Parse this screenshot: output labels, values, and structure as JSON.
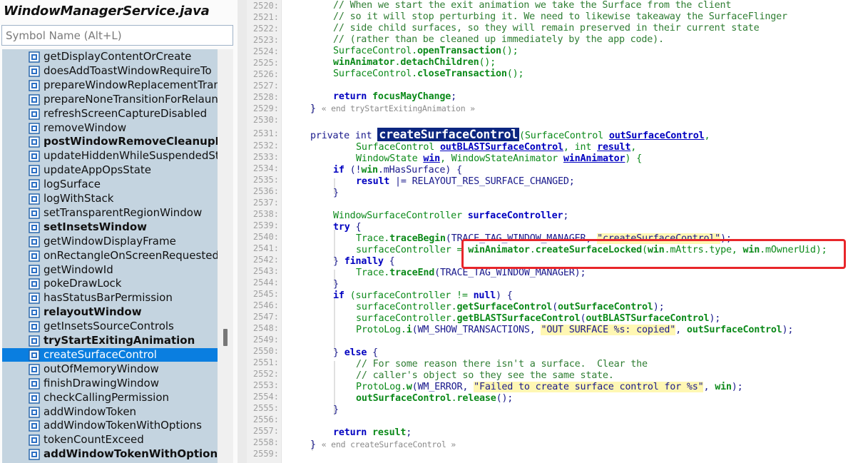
{
  "sidebar": {
    "file_title": "WindowManagerService.java",
    "search_placeholder": "Symbol Name (Alt+L)",
    "symbol_icon": "method-symbol-icon",
    "items": [
      {
        "label": "getDisplayContentOrCreate",
        "bold": false,
        "selected": false
      },
      {
        "label": "doesAddToastWindowRequireTo",
        "bold": false,
        "selected": false
      },
      {
        "label": "prepareWindowReplacementTran",
        "bold": false,
        "selected": false
      },
      {
        "label": "prepareNoneTransitionForRelaun",
        "bold": false,
        "selected": false
      },
      {
        "label": "refreshScreenCaptureDisabled",
        "bold": false,
        "selected": false
      },
      {
        "label": "removeWindow",
        "bold": false,
        "selected": false
      },
      {
        "label": "postWindowRemoveCleanupLoc",
        "bold": true,
        "selected": false
      },
      {
        "label": "updateHiddenWhileSuspendedSt",
        "bold": false,
        "selected": false
      },
      {
        "label": "updateAppOpsState",
        "bold": false,
        "selected": false
      },
      {
        "label": "logSurface",
        "bold": false,
        "selected": false
      },
      {
        "label": "logWithStack",
        "bold": false,
        "selected": false
      },
      {
        "label": "setTransparentRegionWindow",
        "bold": false,
        "selected": false
      },
      {
        "label": "setInsetsWindow",
        "bold": true,
        "selected": false
      },
      {
        "label": "getWindowDisplayFrame",
        "bold": false,
        "selected": false
      },
      {
        "label": "onRectangleOnScreenRequested",
        "bold": false,
        "selected": false
      },
      {
        "label": "getWindowId",
        "bold": false,
        "selected": false
      },
      {
        "label": "pokeDrawLock",
        "bold": false,
        "selected": false
      },
      {
        "label": "hasStatusBarPermission",
        "bold": false,
        "selected": false
      },
      {
        "label": "relayoutWindow",
        "bold": true,
        "selected": false
      },
      {
        "label": "getInsetsSourceControls",
        "bold": false,
        "selected": false
      },
      {
        "label": "tryStartExitingAnimation",
        "bold": true,
        "selected": false
      },
      {
        "label": "createSurfaceControl",
        "bold": false,
        "selected": true
      },
      {
        "label": "outOfMemoryWindow",
        "bold": false,
        "selected": false
      },
      {
        "label": "finishDrawingWindow",
        "bold": false,
        "selected": false
      },
      {
        "label": "checkCallingPermission",
        "bold": false,
        "selected": false
      },
      {
        "label": "addWindowToken",
        "bold": false,
        "selected": false
      },
      {
        "label": "addWindowTokenWithOptions",
        "bold": false,
        "selected": false
      },
      {
        "label": "tokenCountExceed",
        "bold": false,
        "selected": false
      },
      {
        "label": "addWindowTokenWithOptions",
        "bold": true,
        "selected": false
      }
    ]
  },
  "editor": {
    "line_numbers": [
      "2520:",
      "2521:",
      "2522:",
      "2523:",
      "2524:",
      "2525:",
      "2526:",
      "2527:",
      "2528:",
      "2529:",
      "2530:",
      "2531:",
      "2532:",
      "2533:",
      "2534:",
      "2535:",
      "2536:",
      "2537:",
      "2538:",
      "2539:",
      "2540:",
      "2541:",
      "2542:",
      "2543:",
      "2544:",
      "2545:",
      "2546:",
      "2547:",
      "2548:",
      "2549:",
      "2550:",
      "2551:",
      "2552:",
      "2553:",
      "2554:",
      "2555:",
      "2556:",
      "2557:",
      "2558:",
      "2559:"
    ],
    "highlight_color": "#e8262a",
    "tokens": {
      "l2520": "// When we start the exit animation we take the Surface from the client",
      "l2521": "// so it will stop perturbing it. We need to likewise takeaway the SurfaceFlinger",
      "l2522": "// side child surfaces, so they will remain preserved in their current state",
      "l2523": "// (rather than be cleaned up immediately by the app code).",
      "l2524_a": "SurfaceControl.",
      "l2524_b": "openTransaction",
      "l2524_c": "();",
      "l2525_a": "winAnimator",
      "l2525_b": ".",
      "l2525_c": "detachChildren",
      "l2525_d": "();",
      "l2526_a": "SurfaceControl.",
      "l2526_b": "closeTransaction",
      "l2526_c": "();",
      "l2528_a": "return ",
      "l2528_b": "focusMayChange",
      "l2528_c": ";",
      "l2529_a": "} ",
      "l2529_b": "« end tryStartExitingAnimation »",
      "l2531_a": "private int ",
      "l2531_b": "createSurfaceControl",
      "l2531_c": "(SurfaceControl ",
      "l2531_d": "outSurfaceControl",
      "l2531_e": ",",
      "l2532_a": "SurfaceControl ",
      "l2532_b": "outBLASTSurfaceControl",
      "l2532_c": ", int ",
      "l2532_d": "result",
      "l2532_e": ",",
      "l2533_a": "WindowState ",
      "l2533_b": "win",
      "l2533_c": ", WindowStateAnimator ",
      "l2533_d": "winAnimator",
      "l2533_e": ") {",
      "l2534_a": "if",
      "l2534_b": " (!",
      "l2534_c": "win",
      "l2534_d": ".mHasSurface) {",
      "l2535_a": "result",
      "l2535_b": " |= RELAYOUT_RES_SURFACE_CHANGED;",
      "l2536": "}",
      "l2538_a": "WindowSurfaceController ",
      "l2538_b": "surfaceController",
      "l2538_c": ";",
      "l2539_a": "try",
      "l2539_b": " {",
      "l2540_a": "Trace.",
      "l2540_b": "traceBegin",
      "l2540_c": "(TRACE_TAG_WINDOW_MANAGER, ",
      "l2540_d": "\"createSurfaceControl\"",
      "l2540_e": ");",
      "l2541_a": "surfaceController = ",
      "l2541_b": "winAnimator",
      "l2541_c": ".",
      "l2541_d": "createSurfaceLocked",
      "l2541_e": "(",
      "l2541_f": "win",
      "l2541_g": ".mAttrs.type, ",
      "l2541_h": "win",
      "l2541_i": ".mOwnerUid);",
      "l2542_a": "} ",
      "l2542_b": "finally",
      "l2542_c": " {",
      "l2543_a": "Trace.",
      "l2543_b": "traceEnd",
      "l2543_c": "(TRACE_TAG_WINDOW_MANAGER);",
      "l2544": "}",
      "l2545_a": "if",
      "l2545_b": " (surfaceController != ",
      "l2545_c": "null",
      "l2545_d": ") {",
      "l2546_a": "surfaceController.",
      "l2546_b": "getSurfaceControl",
      "l2546_c": "(",
      "l2546_d": "outSurfaceControl",
      "l2546_e": ");",
      "l2547_a": "surfaceController.",
      "l2547_b": "getBLASTSurfaceControl",
      "l2547_c": "(",
      "l2547_d": "outBLASTSurfaceControl",
      "l2547_e": ");",
      "l2548_a": "ProtoLog.",
      "l2548_b": "i",
      "l2548_c": "(WM_SHOW_TRANSACTIONS, ",
      "l2548_d": "\"OUT SURFACE %s: copied\"",
      "l2548_e": ", ",
      "l2548_f": "outSurfaceControl",
      "l2548_g": ");",
      "l2550_a": "} ",
      "l2550_b": "else",
      "l2550_c": " {",
      "l2551": "// For some reason there isn't a surface.  Clear the",
      "l2552": "// caller's object so they see the same state.",
      "l2553_a": "ProtoLog.",
      "l2553_b": "w",
      "l2553_c": "(WM_ERROR, ",
      "l2553_d": "\"Failed to create surface control for %s\"",
      "l2553_e": ", ",
      "l2553_f": "win",
      "l2553_g": ");",
      "l2554_a": "outSurfaceControl",
      "l2554_b": ".",
      "l2554_c": "release",
      "l2554_d": "();",
      "l2555": "}",
      "l2557_a": "return ",
      "l2557_b": "result",
      "l2557_c": ";",
      "l2558_a": "} ",
      "l2558_b": "« end createSurfaceControl »"
    }
  }
}
